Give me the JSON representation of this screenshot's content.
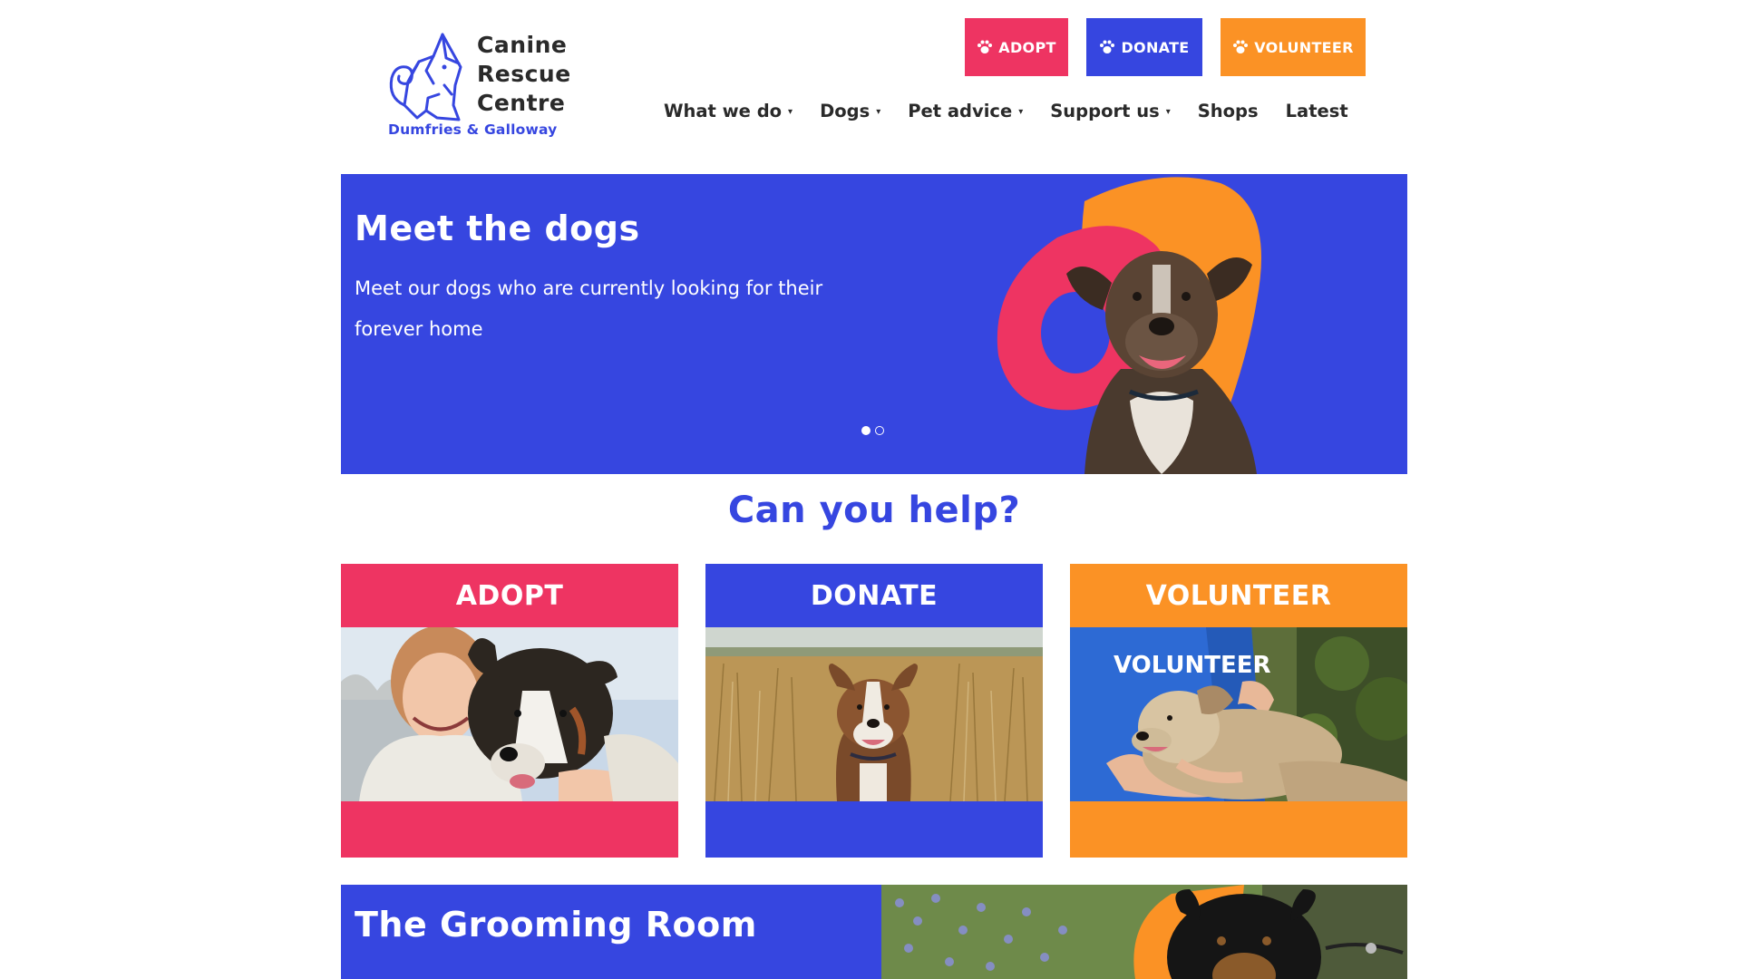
{
  "colors": {
    "pink": "#ee3462",
    "blue": "#3646e0",
    "orange": "#fb9225",
    "dark": "#2a2a2a"
  },
  "logo": {
    "line1": "Canine",
    "line2": "Rescue",
    "line3": "Centre",
    "subtitle": "Dumfries & Galloway",
    "icon": "howling-dog-logo"
  },
  "header_buttons": {
    "adopt": "ADOPT",
    "donate": "DONATE",
    "volunteer": "VOLUNTEER",
    "icon": "paw-icon"
  },
  "nav": {
    "items": [
      {
        "label": "What we do",
        "dropdown": true
      },
      {
        "label": "Dogs",
        "dropdown": true
      },
      {
        "label": "Pet advice",
        "dropdown": true
      },
      {
        "label": "Support us",
        "dropdown": true
      },
      {
        "label": "Shops",
        "dropdown": false
      },
      {
        "label": "Latest",
        "dropdown": false
      }
    ],
    "caret": "⌄"
  },
  "hero": {
    "title": "Meet the dogs",
    "text": "Meet our dogs who are currently looking for their forever home",
    "slides": 2,
    "active_slide": 1
  },
  "help": {
    "title": "Can you help?",
    "cards": [
      {
        "label": "ADOPT",
        "image": "woman hugging dog photo"
      },
      {
        "label": "DONATE",
        "image": "dog in wheat field photo"
      },
      {
        "label": "VOLUNTEER",
        "image": "volunteer petting dog photo",
        "shirt_text": "VOLUNTEER"
      }
    ]
  },
  "grooming": {
    "title": "The Grooming Room"
  }
}
